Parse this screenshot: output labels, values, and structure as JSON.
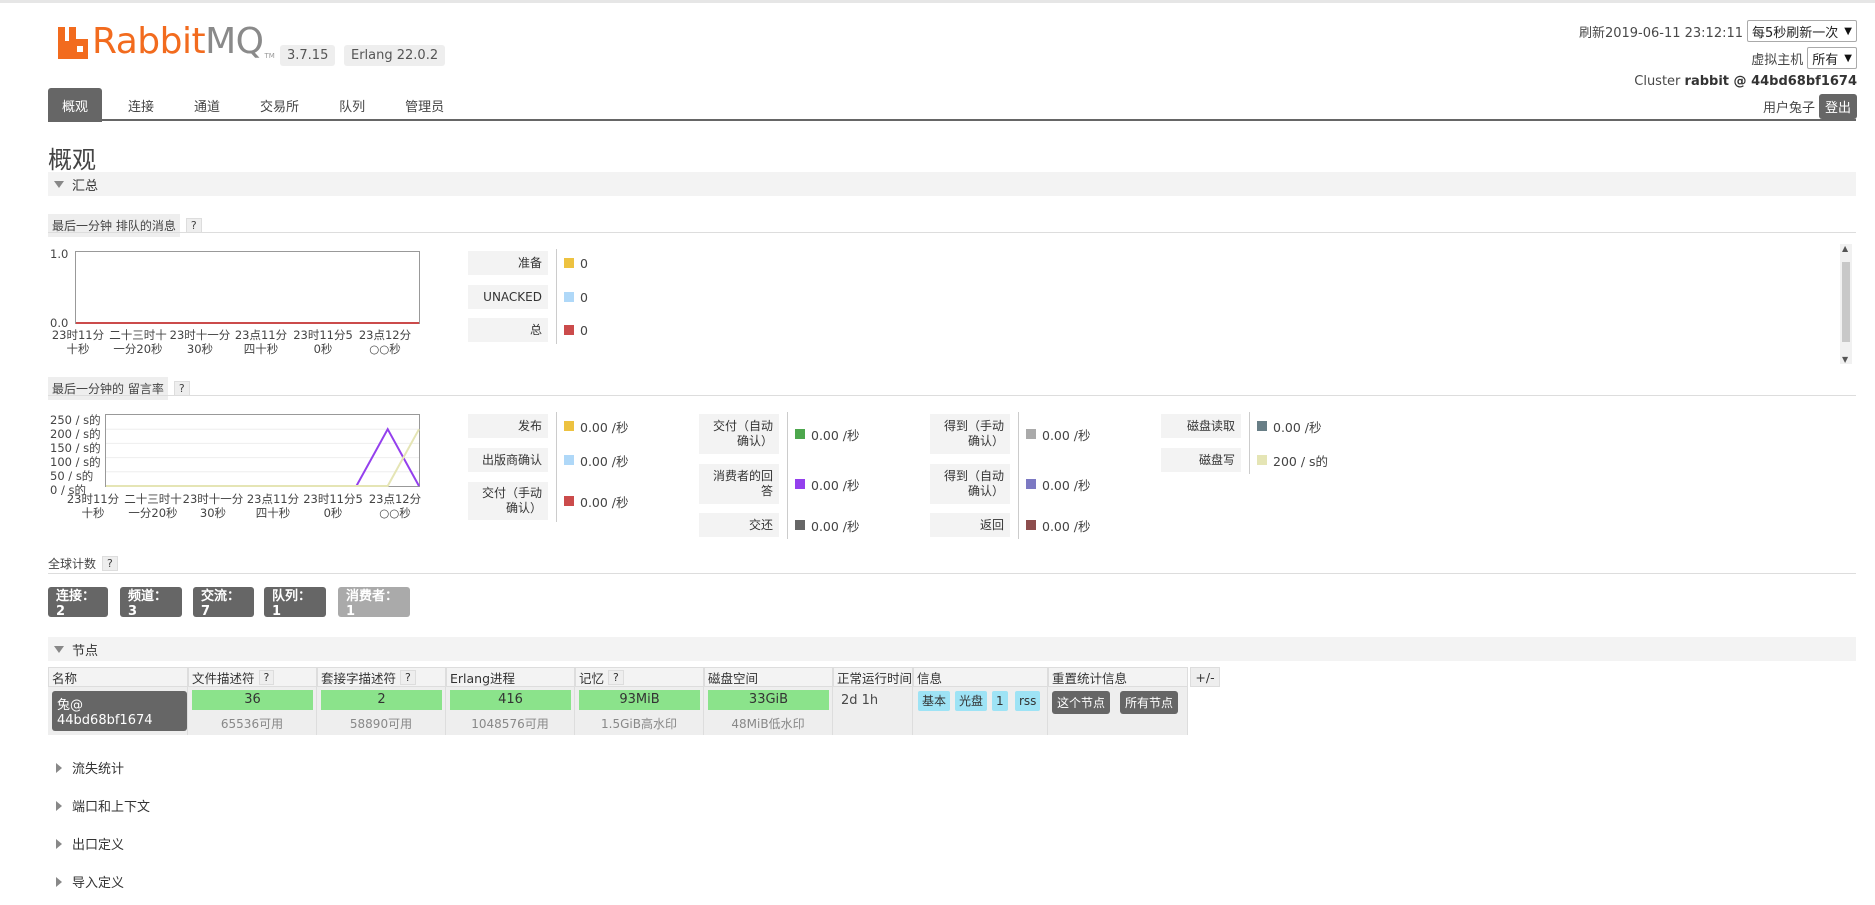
{
  "app": {
    "logo_text_rabbit": "Rabbit",
    "logo_text_mq": "MQ",
    "logo_tm": "TM",
    "version": "3.7.15",
    "erlang": "Erlang 22.0.2"
  },
  "header": {
    "refreshed": "刷新2019-06-11 23:12:11",
    "refresh_interval": "每5秒刷新一次",
    "vhost_label": "虚拟主机",
    "vhost_value": "所有",
    "cluster_label": "Cluster",
    "cluster_name": "rabbit @ 44bd68bf1674",
    "user_label": "用户兔子",
    "logout": "登出"
  },
  "tabs": [
    "概观",
    "连接",
    "通道",
    "交易所",
    "队列",
    "管理员"
  ],
  "page_title": "概观",
  "summary": {
    "title": "汇总",
    "queued_title_a": "最后一分钟",
    "queued_title_b": "排队的消息",
    "rates_title_a": "最后一分钟的",
    "rates_title_b": "留言率",
    "help": "?",
    "queued_legend": [
      {
        "label": "准备",
        "value": "0",
        "color": "#edc240"
      },
      {
        "label": "UNACKED",
        "value": "0",
        "color": "#afd8f8"
      },
      {
        "label": "总",
        "value": "0",
        "color": "#cb4b4b"
      }
    ],
    "rates_legend_col1": [
      {
        "label": "发布",
        "value": "0.00 /秒",
        "color": "#edc240"
      },
      {
        "label": "出版商确认",
        "value": "0.00 /秒",
        "color": "#afd8f8"
      },
      {
        "label": "交付（手动确认）",
        "value": "0.00 /秒",
        "color": "#cb4b4b"
      }
    ],
    "rates_legend_col2": [
      {
        "label": "交付（自动确认）",
        "value": "0.00 /秒",
        "color": "#4da74d"
      },
      {
        "label": "消费者的回答",
        "value": "0.00 /秒",
        "color": "#9440ed"
      },
      {
        "label": "交还",
        "value": "0.00 /秒",
        "color": "#666666"
      }
    ],
    "rates_legend_col3": [
      {
        "label": "得到（手动确认）",
        "value": "0.00 /秒",
        "color": "#aaaaaa"
      },
      {
        "label": "得到（自动确认）",
        "value": "0.00 /秒",
        "color": "#7c79c3"
      },
      {
        "label": "返回",
        "value": "0.00 /秒",
        "color": "#8d4d4d"
      }
    ],
    "rates_legend_col4": [
      {
        "label": "磁盘读取",
        "value": "0.00 /秒",
        "color": "#687e86"
      },
      {
        "label": "磁盘写",
        "value": "200 / s的",
        "color": "#e5e5b5"
      }
    ],
    "global_counts_title": "全球计数",
    "counts": [
      {
        "label": "连接：2"
      },
      {
        "label": "频道：3"
      },
      {
        "label": "交流：7"
      },
      {
        "label": "队列：1"
      },
      {
        "label": "消费者：1"
      }
    ]
  },
  "chart_data": [
    {
      "type": "line",
      "title": "",
      "ylabels": [
        "1.0",
        "0.0"
      ],
      "ylim": [
        0,
        1
      ],
      "categories": [
        "23时11分十秒",
        "二十三时十一分20秒",
        "23时十一分30秒",
        "23点11分四十秒",
        "23时11分50秒",
        "23点12分○○秒"
      ],
      "series": [
        {
          "name": "准备",
          "values": [
            0,
            0,
            0,
            0,
            0,
            0
          ]
        },
        {
          "name": "UNACKED",
          "values": [
            0,
            0,
            0,
            0,
            0,
            0
          ]
        },
        {
          "name": "总",
          "values": [
            0,
            0,
            0,
            0,
            0,
            0
          ]
        }
      ]
    },
    {
      "type": "line",
      "title": "",
      "ylabels": [
        "250 / s的",
        "200 / s的",
        "150 / s的",
        "100 / s的",
        "50 / s的",
        "0 / s的"
      ],
      "ylim": [
        0,
        250
      ],
      "categories": [
        "23时11分十秒",
        "二十三时十一分20秒",
        "23时十一分30秒",
        "23点11分四十秒",
        "23时11分50秒",
        "23点12分○○秒"
      ],
      "series": [
        {
          "name": "消费者的回答",
          "x": [
            0,
            0.8,
            0.9,
            1.0
          ],
          "values": [
            0,
            0,
            200,
            0
          ]
        },
        {
          "name": "磁盘写",
          "x": [
            0,
            0.9,
            1.0
          ],
          "values": [
            0,
            0,
            200
          ]
        }
      ]
    }
  ],
  "nodes": {
    "title": "节点",
    "plus_minus": "+/-",
    "headers": [
      "名称",
      "文件描述符",
      "套接字描述符",
      "Erlang进程",
      "记忆",
      "磁盘空间",
      "正常运行时间",
      "信息",
      "重置统计信息"
    ],
    "row": {
      "name": "兔@ 44bd68bf1674",
      "fd": "36",
      "fd_sub": "65536可用",
      "sockets": "2",
      "sockets_sub": "58890可用",
      "procs": "416",
      "procs_sub": "1048576可用",
      "memory": "93MiB",
      "memory_sub": "1.5GiB高水印",
      "disk": "33GiB",
      "disk_sub": "48MiB低水印",
      "uptime": "2d 1h",
      "info": [
        "基本",
        "光盘",
        "1",
        "rss"
      ],
      "reset_this": "这个节点",
      "reset_all": "所有节点"
    }
  },
  "collapsed_sections": [
    "流失统计",
    "端口和上下文",
    "出口定义",
    "导入定义"
  ]
}
